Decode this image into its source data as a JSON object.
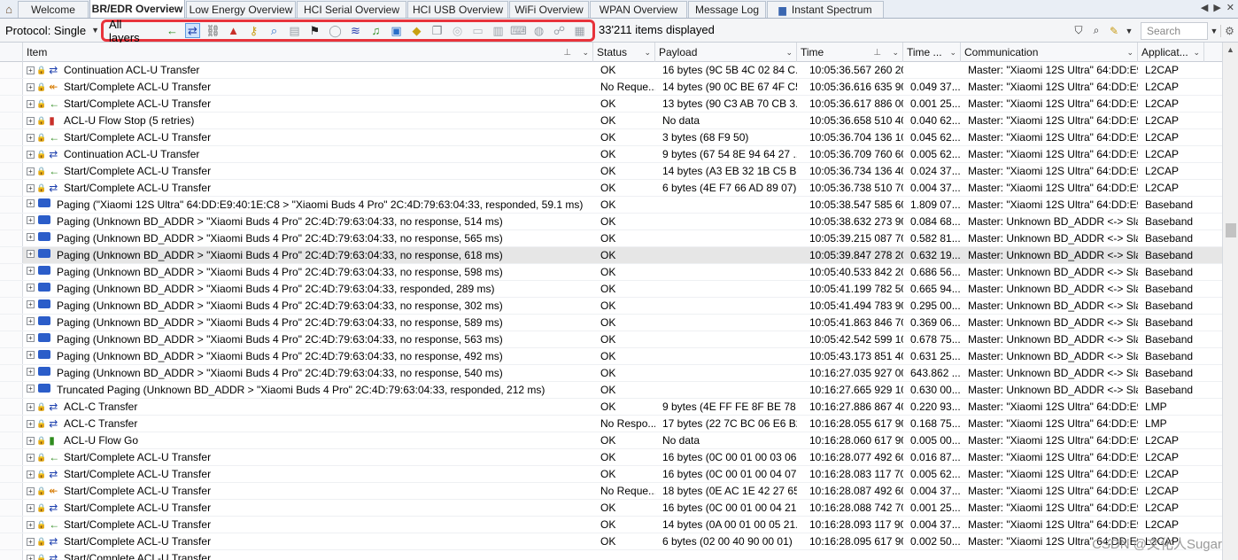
{
  "tabs": [
    {
      "label": "Welcome",
      "active": false
    },
    {
      "label": "BR/EDR Overview",
      "active": true
    },
    {
      "label": "Low Energy Overview",
      "active": false
    },
    {
      "label": "HCI Serial Overview",
      "active": false
    },
    {
      "label": "HCI USB Overview",
      "active": false
    },
    {
      "label": "WiFi Overview",
      "active": false
    },
    {
      "label": "WPAN Overview",
      "active": false
    },
    {
      "label": "Message Log",
      "active": false
    },
    {
      "label": "Instant Spectrum",
      "active": false
    }
  ],
  "toolbar": {
    "protocol_label": "Protocol: Single",
    "layers_label": "All layers",
    "items_count": "33'211 items displayed",
    "search_placeholder": "Search"
  },
  "layer_icons": [
    {
      "name": "left-arrow-icon",
      "glyph": "←",
      "color": "#2e8b1e",
      "state": "normal"
    },
    {
      "name": "bidirectional-arrows-icon",
      "glyph": "⇄",
      "color": "#1c3fae",
      "state": "selected"
    },
    {
      "name": "chain-link-icon",
      "glyph": "⛓",
      "color": "#555555",
      "state": "normal"
    },
    {
      "name": "hat-icon",
      "glyph": "▲",
      "color": "#c8302a",
      "state": "normal"
    },
    {
      "name": "key-icon",
      "glyph": "⚷",
      "color": "#c89a12",
      "state": "normal"
    },
    {
      "name": "magnifier-icon",
      "glyph": "⌕",
      "color": "#2a6fc9",
      "state": "normal"
    },
    {
      "name": "document-icon",
      "glyph": "▤",
      "color": "#9aa0a8",
      "state": "dim"
    },
    {
      "name": "checkered-flag-icon",
      "glyph": "⚑",
      "color": "#222222",
      "state": "normal"
    },
    {
      "name": "mouse-icon",
      "glyph": "◯",
      "color": "#9aa0a8",
      "state": "dim"
    },
    {
      "name": "waveform-icon",
      "glyph": "≋",
      "color": "#2b3fb0",
      "state": "normal"
    },
    {
      "name": "music-note-icon",
      "glyph": "♫",
      "color": "#2e8b1e",
      "state": "normal"
    },
    {
      "name": "media-player-icon",
      "glyph": "▣",
      "color": "#2a6fc9",
      "state": "normal"
    },
    {
      "name": "package-icon",
      "glyph": "◆",
      "color": "#c8a112",
      "state": "normal"
    },
    {
      "name": "copy-icon",
      "glyph": "❐",
      "color": "#7c8188",
      "state": "normal"
    },
    {
      "name": "globe-disabled-icon",
      "glyph": "◎",
      "color": "#b5b9bf",
      "state": "dim"
    },
    {
      "name": "card-icon",
      "glyph": "▭",
      "color": "#b5b9bf",
      "state": "dim"
    },
    {
      "name": "book-icon",
      "glyph": "▥",
      "color": "#9aa0a8",
      "state": "dim"
    },
    {
      "name": "keyboard-icon",
      "glyph": "⌨",
      "color": "#9aa0a8",
      "state": "dim"
    },
    {
      "name": "globe-icon",
      "glyph": "◍",
      "color": "#9aa0a8",
      "state": "dim"
    },
    {
      "name": "network-icon",
      "glyph": "☍",
      "color": "#9aa0a8",
      "state": "dim"
    },
    {
      "name": "stack-icon",
      "glyph": "▦",
      "color": "#9aa0a8",
      "state": "dim"
    }
  ],
  "columns": [
    "Item",
    "Status",
    "Payload",
    "Time",
    "Time ...",
    "Communication",
    "Applicat..."
  ],
  "rows": [
    {
      "item": "Continuation ACL-U Transfer",
      "status": "OK",
      "payload": "16 bytes (9C 5B 4C 02 84 C...",
      "time": "10:05:36.567 260 200",
      "delta": "",
      "comm": "Master: \"Xiaomi 12S Ultra\" 64:DD:E9:...",
      "app": "L2CAP",
      "kind": "blue",
      "lock": "red"
    },
    {
      "item": "Start/Complete ACL-U Transfer",
      "status": "No Reque...",
      "payload": "14 bytes (90 0C BE 67 4F C5...",
      "time": "10:05:36.616 635 900",
      "delta": "0.049 37...",
      "comm": "Master: \"Xiaomi 12S Ultra\" 64:DD:E9:...",
      "app": "L2CAP",
      "kind": "orange",
      "lock": "red"
    },
    {
      "item": "Start/Complete ACL-U Transfer",
      "status": "OK",
      "payload": "13 bytes (90 C3 AB 70 CB 3...",
      "time": "10:05:36.617 886 000",
      "delta": "0.001 25...",
      "comm": "Master: \"Xiaomi 12S Ultra\" 64:DD:E9:...",
      "app": "L2CAP",
      "kind": "green",
      "lock": "red"
    },
    {
      "item": "ACL-U Flow Stop (5 retries)",
      "status": "OK",
      "payload": "No data",
      "time": "10:05:36.658 510 400",
      "delta": "0.040 62...",
      "comm": "Master: \"Xiaomi 12S Ultra\" 64:DD:E9:...",
      "app": "L2CAP",
      "kind": "stop",
      "lock": "red"
    },
    {
      "item": "Start/Complete ACL-U Transfer",
      "status": "OK",
      "payload": "3 bytes (68 F9 50)",
      "time": "10:05:36.704 136 100",
      "delta": "0.045 62...",
      "comm": "Master: \"Xiaomi 12S Ultra\" 64:DD:E9:...",
      "app": "L2CAP",
      "kind": "green",
      "lock": "red"
    },
    {
      "item": "Continuation ACL-U Transfer",
      "status": "OK",
      "payload": "9 bytes (67 54 8E 94 64 27 ...",
      "time": "10:05:36.709 760 600",
      "delta": "0.005 62...",
      "comm": "Master: \"Xiaomi 12S Ultra\" 64:DD:E9:...",
      "app": "L2CAP",
      "kind": "blue",
      "lock": "red"
    },
    {
      "item": "Start/Complete ACL-U Transfer",
      "status": "OK",
      "payload": "14 bytes (A3 EB 32 1B C5 B9...",
      "time": "10:05:36.734 136 400",
      "delta": "0.024 37...",
      "comm": "Master: \"Xiaomi 12S Ultra\" 64:DD:E9:...",
      "app": "L2CAP",
      "kind": "green",
      "lock": "red"
    },
    {
      "item": "Start/Complete ACL-U Transfer",
      "status": "OK",
      "payload": "6 bytes (4E F7 66 AD 89 07)",
      "time": "10:05:36.738 510 700",
      "delta": "0.004 37...",
      "comm": "Master: \"Xiaomi 12S Ultra\" 64:DD:E9:...",
      "app": "L2CAP",
      "kind": "blue",
      "lock": "red"
    },
    {
      "item": "Paging (\"Xiaomi 12S Ultra\" 64:DD:E9:40:1E:C8 > \"Xiaomi Buds 4 Pro\" 2C:4D:79:63:04:33, responded, 59.1 ms)",
      "status": "OK",
      "payload": "",
      "time": "10:05:38.547 585 600",
      "delta": "1.809 07...",
      "comm": "Master: \"Xiaomi 12S Ultra\" 64:DD:E9:...",
      "app": "Baseband",
      "kind": "paging",
      "lock": ""
    },
    {
      "item": "Paging (Unknown BD_ADDR > \"Xiaomi Buds 4 Pro\" 2C:4D:79:63:04:33, no response, 514 ms)",
      "status": "OK",
      "payload": "",
      "time": "10:05:38.632 273 900",
      "delta": "0.084 68...",
      "comm": "Master: Unknown BD_ADDR <-> Sla...",
      "app": "Baseband",
      "kind": "paging",
      "lock": ""
    },
    {
      "item": "Paging (Unknown BD_ADDR > \"Xiaomi Buds 4 Pro\" 2C:4D:79:63:04:33, no response, 565 ms)",
      "status": "OK",
      "payload": "",
      "time": "10:05:39.215 087 700",
      "delta": "0.582 81...",
      "comm": "Master: Unknown BD_ADDR <-> Sla...",
      "app": "Baseband",
      "kind": "paging",
      "lock": ""
    },
    {
      "item": "Paging (Unknown BD_ADDR > \"Xiaomi Buds 4 Pro\" 2C:4D:79:63:04:33, no response, 618 ms)",
      "status": "OK",
      "payload": "",
      "time": "10:05:39.847 278 200",
      "delta": "0.632 19...",
      "comm": "Master: Unknown BD_ADDR <-> Sla...",
      "app": "Baseband",
      "kind": "paging",
      "lock": "",
      "selected": true
    },
    {
      "item": "Paging (Unknown BD_ADDR > \"Xiaomi Buds 4 Pro\" 2C:4D:79:63:04:33, no response, 598 ms)",
      "status": "OK",
      "payload": "",
      "time": "10:05:40.533 842 200",
      "delta": "0.686 56...",
      "comm": "Master: Unknown BD_ADDR <-> Sla...",
      "app": "Baseband",
      "kind": "paging",
      "lock": ""
    },
    {
      "item": "Paging (Unknown BD_ADDR > \"Xiaomi Buds 4 Pro\" 2C:4D:79:63:04:33, responded, 289 ms)",
      "status": "OK",
      "payload": "",
      "time": "10:05:41.199 782 500",
      "delta": "0.665 94...",
      "comm": "Master: Unknown BD_ADDR <-> Sla...",
      "app": "Baseband",
      "kind": "paging",
      "lock": ""
    },
    {
      "item": "Paging (Unknown BD_ADDR > \"Xiaomi Buds 4 Pro\" 2C:4D:79:63:04:33, no response, 302 ms)",
      "status": "OK",
      "payload": "",
      "time": "10:05:41.494 783 900",
      "delta": "0.295 00...",
      "comm": "Master: Unknown BD_ADDR <-> Sla...",
      "app": "Baseband",
      "kind": "paging",
      "lock": ""
    },
    {
      "item": "Paging (Unknown BD_ADDR > \"Xiaomi Buds 4 Pro\" 2C:4D:79:63:04:33, no response, 589 ms)",
      "status": "OK",
      "payload": "",
      "time": "10:05:41.863 846 700",
      "delta": "0.369 06...",
      "comm": "Master: Unknown BD_ADDR <-> Sla...",
      "app": "Baseband",
      "kind": "paging",
      "lock": ""
    },
    {
      "item": "Paging (Unknown BD_ADDR > \"Xiaomi Buds 4 Pro\" 2C:4D:79:63:04:33, no response, 563 ms)",
      "status": "OK",
      "payload": "",
      "time": "10:05:42.542 599 100",
      "delta": "0.678 75...",
      "comm": "Master: Unknown BD_ADDR <-> Sla...",
      "app": "Baseband",
      "kind": "paging",
      "lock": ""
    },
    {
      "item": "Paging (Unknown BD_ADDR > \"Xiaomi Buds 4 Pro\" 2C:4D:79:63:04:33, no response, 492 ms)",
      "status": "OK",
      "payload": "",
      "time": "10:05:43.173 851 400",
      "delta": "0.631 25...",
      "comm": "Master: Unknown BD_ADDR <-> Sla...",
      "app": "Baseband",
      "kind": "paging",
      "lock": ""
    },
    {
      "item": "Paging (Unknown BD_ADDR > \"Xiaomi Buds 4 Pro\" 2C:4D:79:63:04:33, no response, 540 ms)",
      "status": "OK",
      "payload": "",
      "time": "10:16:27.035 927 000",
      "delta": "643.862 ...",
      "comm": "Master: Unknown BD_ADDR <-> Sla...",
      "app": "Baseband",
      "kind": "paging",
      "lock": ""
    },
    {
      "item": "Truncated Paging (Unknown BD_ADDR > \"Xiaomi Buds 4 Pro\" 2C:4D:79:63:04:33, responded, 212 ms)",
      "status": "OK",
      "payload": "",
      "time": "10:16:27.665 929 100",
      "delta": "0.630 00...",
      "comm": "Master: Unknown BD_ADDR <-> Sla...",
      "app": "Baseband",
      "kind": "paging",
      "lock": ""
    },
    {
      "item": "ACL-C Transfer",
      "status": "OK",
      "payload": "9 bytes (4E FF FE 8F BE 78 ...",
      "time": "10:16:27.886 867 400",
      "delta": "0.220 93...",
      "comm": "Master: \"Xiaomi 12S Ultra\" 64:DD:E9:...",
      "app": "LMP",
      "kind": "blue",
      "lock": "gray"
    },
    {
      "item": "ACL-C Transfer",
      "status": "No Respo...",
      "payload": "17 bytes (22 7C BC 06 E6 B2...",
      "time": "10:16:28.055 617 900",
      "delta": "0.168 75...",
      "comm": "Master: \"Xiaomi 12S Ultra\" 64:DD:E9:...",
      "app": "LMP",
      "kind": "blue",
      "lock": "gray"
    },
    {
      "item": "ACL-U Flow Go",
      "status": "OK",
      "payload": "No data",
      "time": "10:16:28.060 617 900",
      "delta": "0.005 00...",
      "comm": "Master: \"Xiaomi 12S Ultra\" 64:DD:E9:...",
      "app": "L2CAP",
      "kind": "go",
      "lock": "green"
    },
    {
      "item": "Start/Complete ACL-U Transfer",
      "status": "OK",
      "payload": "16 bytes (0C 00 01 00 03 06...",
      "time": "10:16:28.077 492 600",
      "delta": "0.016 87...",
      "comm": "Master: \"Xiaomi 12S Ultra\" 64:DD:E9:...",
      "app": "L2CAP",
      "kind": "green",
      "lock": "green"
    },
    {
      "item": "Start/Complete ACL-U Transfer",
      "status": "OK",
      "payload": "16 bytes (0C 00 01 00 04 07...",
      "time": "10:16:28.083 117 700",
      "delta": "0.005 62...",
      "comm": "Master: \"Xiaomi 12S Ultra\" 64:DD:E9:...",
      "app": "L2CAP",
      "kind": "blue",
      "lock": "green"
    },
    {
      "item": "Start/Complete ACL-U Transfer",
      "status": "No Reque...",
      "payload": "18 bytes (0E AC 1E 42 27 65...",
      "time": "10:16:28.087 492 600",
      "delta": "0.004 37...",
      "comm": "Master: \"Xiaomi 12S Ultra\" 64:DD:E9:...",
      "app": "L2CAP",
      "kind": "orange",
      "lock": "green"
    },
    {
      "item": "Start/Complete ACL-U Transfer",
      "status": "OK",
      "payload": "16 bytes (0C 00 01 00 04 21...",
      "time": "10:16:28.088 742 700",
      "delta": "0.001 25...",
      "comm": "Master: \"Xiaomi 12S Ultra\" 64:DD:E9:...",
      "app": "L2CAP",
      "kind": "blue",
      "lock": "green"
    },
    {
      "item": "Start/Complete ACL-U Transfer",
      "status": "OK",
      "payload": "14 bytes (0A 00 01 00 05 21...",
      "time": "10:16:28.093 117 900",
      "delta": "0.004 37...",
      "comm": "Master: \"Xiaomi 12S Ultra\" 64:DD:E9:...",
      "app": "L2CAP",
      "kind": "green",
      "lock": "green"
    },
    {
      "item": "Start/Complete ACL-U Transfer",
      "status": "OK",
      "payload": "6 bytes (02 00 40 90 00 01)",
      "time": "10:16:28.095 617 900",
      "delta": "0.002 50...",
      "comm": "Master: \"Xiaomi 12S Ultra\" 64:DD:E9:...",
      "app": "L2CAP",
      "kind": "blue",
      "lock": "green"
    },
    {
      "item": "Start/Complete ACL-U Transfer",
      "status": "",
      "payload": "",
      "time": "",
      "delta": "",
      "comm": "",
      "app": "",
      "kind": "blue",
      "lock": "green"
    }
  ],
  "watermark": "CSDN @文化人Sugar"
}
